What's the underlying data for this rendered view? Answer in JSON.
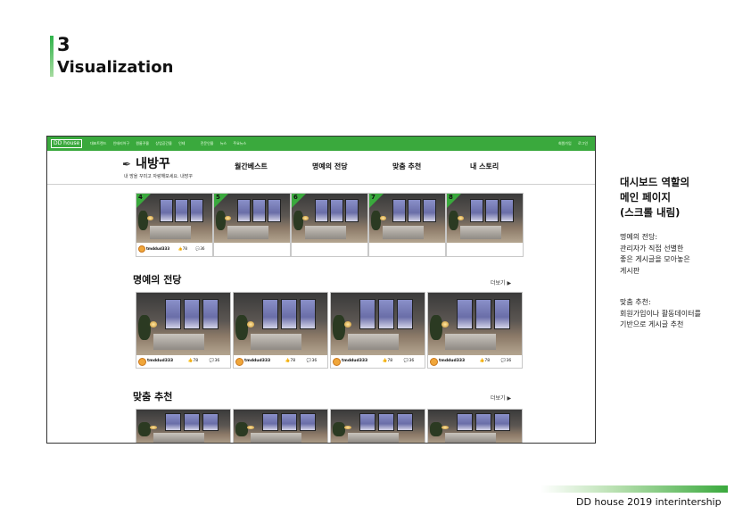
{
  "slide": {
    "number": "3",
    "title": "Visualization"
  },
  "app": {
    "logo": "DD house",
    "top_links": [
      "대표트렌드",
      "인테리어구",
      "원룸꾸몰",
      "상업공간몰",
      "인테",
      "전문인몰",
      "뉴스",
      "주요뉴스"
    ],
    "top_right": [
      "회원가입",
      "로그인"
    ],
    "brand_name": "내방꾸",
    "slogan": "내 방을 꾸미고 자랑해보세요. 내방꾸",
    "menu": [
      "월간베스트",
      "명예의 전당",
      "맞춤 추천",
      "내 스토리"
    ],
    "row1_ranks": [
      "4",
      "5",
      "6",
      "7",
      "8"
    ],
    "card_meta": {
      "user": "tmddud333",
      "likes": "78",
      "comments": "36"
    },
    "hall_of_fame": {
      "title": "명예의 전당",
      "more": "더보기 ▶"
    },
    "recommend": {
      "title": "맞춤 추천",
      "more": "더보기 ▶"
    }
  },
  "side": {
    "title_lines": [
      "대시보드 역할의",
      "메인 페이지",
      "(스크롤 내림)"
    ],
    "hall_lines": [
      "명예의 전당:",
      "관리자가 직접 선별한",
      "좋은 게시글을 모아놓은",
      "게시판"
    ],
    "recommend_lines": [
      "맞춤 추천:",
      "회원가입이나 활동데이터를",
      "기반으로 게시글 추천"
    ]
  },
  "footer": {
    "text": "DD house 2019 interintership"
  },
  "colors": {
    "accent": "#3aa93d"
  }
}
